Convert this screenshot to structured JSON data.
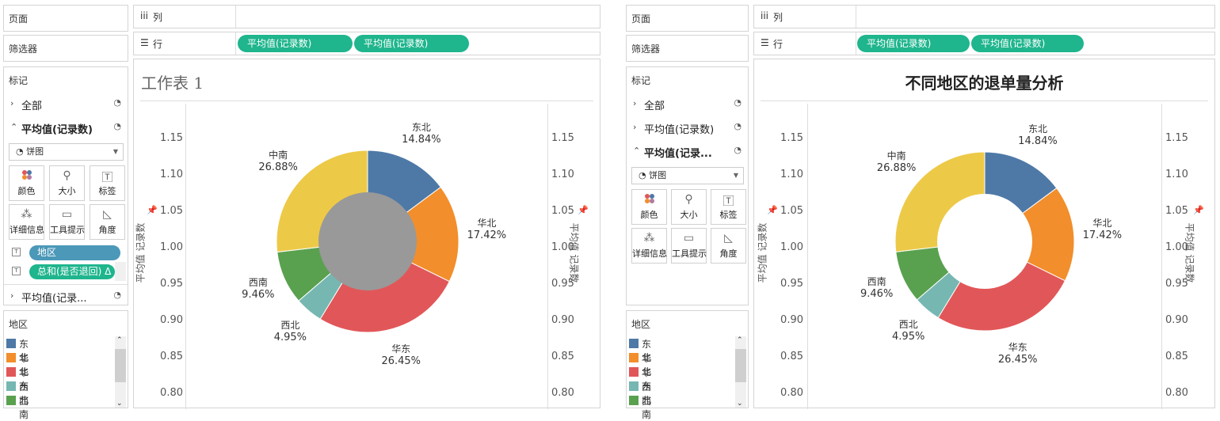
{
  "left": {
    "sidebar": {
      "pages_label": "页面",
      "filters_label": "筛选器",
      "marks_label": "标记",
      "mark_rows": [
        {
          "arrow": "›",
          "label": "全部"
        },
        {
          "arrow": "⌃",
          "label": "平均值(记录数)"
        }
      ],
      "mark_row_bottom": {
        "arrow": "›",
        "label": "平均值(记录..."
      },
      "mark_type": "饼图",
      "mark_buttons": [
        "颜色",
        "大小",
        "标签",
        "详细信息",
        "工具提示",
        "角度"
      ],
      "fields": [
        {
          "label": "地区",
          "color": "#4b98b8"
        },
        {
          "label": "总和(是否退回) Δ",
          "color": "#1fb58d"
        }
      ],
      "legend_title": "地区"
    },
    "columns_label": "列",
    "rows_label": "行",
    "row_pills": [
      "平均值(记录数)",
      "平均值(记录数)"
    ],
    "sheet_title": "工作表 1"
  },
  "right": {
    "sidebar": {
      "pages_label": "页面",
      "filters_label": "筛选器",
      "marks_label": "标记",
      "mark_rows": [
        {
          "arrow": "›",
          "label": "全部"
        },
        {
          "arrow": "›",
          "label": "平均值(记录数)"
        },
        {
          "arrow": "⌃",
          "label": "平均值(记录..."
        }
      ],
      "mark_type": "饼图",
      "mark_buttons": [
        "颜色",
        "大小",
        "标签",
        "详细信息",
        "工具提示",
        "角度"
      ],
      "legend_title": "地区"
    },
    "columns_label": "列",
    "rows_label": "行",
    "row_pills": [
      "平均值(记录数)",
      "平均值(记录数)"
    ],
    "sheet_title": "不同地区的退单量分析"
  },
  "legend": [
    {
      "label": "东北",
      "color": "#4e79a7"
    },
    {
      "label": "华北",
      "color": "#f28e2b"
    },
    {
      "label": "华东",
      "color": "#e15759"
    },
    {
      "label": "西北",
      "color": "#76b7b2"
    },
    {
      "label": "西南",
      "color": "#59a14f"
    }
  ],
  "chart_data": {
    "type": "pie",
    "categories": [
      "东北",
      "华北",
      "华东",
      "西北",
      "西南",
      "中南"
    ],
    "values": [
      14.84,
      17.42,
      26.45,
      4.95,
      9.46,
      26.88
    ],
    "value_labels": [
      "14.84%",
      "17.42%",
      "26.45%",
      "4.95%",
      "9.46%",
      "26.88%"
    ],
    "colors": [
      "#4e79a7",
      "#f28e2b",
      "#e15759",
      "#76b7b2",
      "#59a14f",
      "#edc948"
    ],
    "axis_label": "平均值 记录数",
    "ticks": [
      "1.15",
      "1.10",
      "1.05",
      "1.00",
      "0.95",
      "0.90",
      "0.85",
      "0.80"
    ],
    "ylim": [
      0.8,
      1.15
    ]
  }
}
